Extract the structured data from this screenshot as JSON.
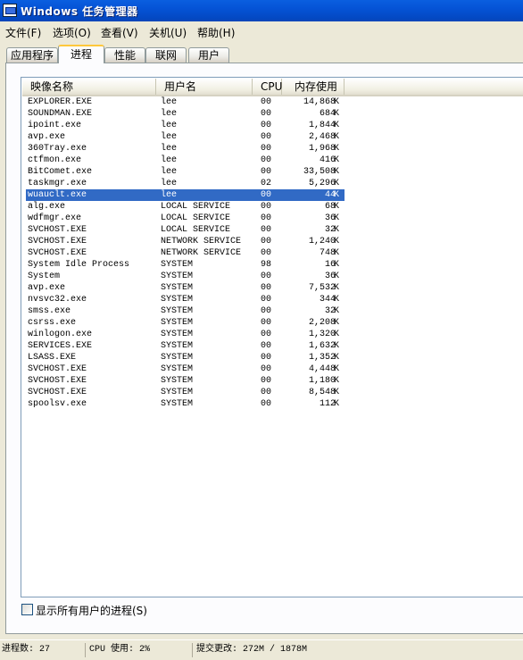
{
  "window": {
    "title": "Windows 任务管理器"
  },
  "menu": [
    "文件(F)",
    "选项(O)",
    "查看(V)",
    "关机(U)",
    "帮助(H)"
  ],
  "tabs": [
    "应用程序",
    "进程",
    "性能",
    "联网",
    "用户"
  ],
  "active_tab": "进程",
  "columns": {
    "name": "映像名称",
    "user": "用户名",
    "cpu": "CPU",
    "mem": "内存使用"
  },
  "processes": [
    {
      "name": "EXPLORER.EXE",
      "user": "lee",
      "cpu": "00",
      "mem": "14,868",
      "unit": "K"
    },
    {
      "name": "SOUNDMAN.EXE",
      "user": "lee",
      "cpu": "00",
      "mem": "684",
      "unit": "K"
    },
    {
      "name": "ipoint.exe",
      "user": "lee",
      "cpu": "00",
      "mem": "1,844",
      "unit": "K"
    },
    {
      "name": "avp.exe",
      "user": "lee",
      "cpu": "00",
      "mem": "2,468",
      "unit": "K"
    },
    {
      "name": "360Tray.exe",
      "user": "lee",
      "cpu": "00",
      "mem": "1,968",
      "unit": "K"
    },
    {
      "name": "ctfmon.exe",
      "user": "lee",
      "cpu": "00",
      "mem": "416",
      "unit": "K"
    },
    {
      "name": "BitComet.exe",
      "user": "lee",
      "cpu": "00",
      "mem": "33,508",
      "unit": "K"
    },
    {
      "name": "taskmgr.exe",
      "user": "lee",
      "cpu": "02",
      "mem": "5,296",
      "unit": "K"
    },
    {
      "name": "wuauclt.exe",
      "user": "lee",
      "cpu": "00",
      "mem": "44",
      "unit": "K",
      "selected": true
    },
    {
      "name": "alg.exe",
      "user": "LOCAL SERVICE",
      "cpu": "00",
      "mem": "68",
      "unit": "K"
    },
    {
      "name": "wdfmgr.exe",
      "user": "LOCAL SERVICE",
      "cpu": "00",
      "mem": "36",
      "unit": "K"
    },
    {
      "name": "SVCHOST.EXE",
      "user": "LOCAL SERVICE",
      "cpu": "00",
      "mem": "32",
      "unit": "K"
    },
    {
      "name": "SVCHOST.EXE",
      "user": "NETWORK SERVICE",
      "cpu": "00",
      "mem": "1,240",
      "unit": "K"
    },
    {
      "name": "SVCHOST.EXE",
      "user": "NETWORK SERVICE",
      "cpu": "00",
      "mem": "748",
      "unit": "K"
    },
    {
      "name": "System Idle Process",
      "user": "SYSTEM",
      "cpu": "98",
      "mem": "16",
      "unit": "K"
    },
    {
      "name": "System",
      "user": "SYSTEM",
      "cpu": "00",
      "mem": "36",
      "unit": "K"
    },
    {
      "name": "avp.exe",
      "user": "SYSTEM",
      "cpu": "00",
      "mem": "7,532",
      "unit": "K"
    },
    {
      "name": "nvsvc32.exe",
      "user": "SYSTEM",
      "cpu": "00",
      "mem": "344",
      "unit": "K"
    },
    {
      "name": "smss.exe",
      "user": "SYSTEM",
      "cpu": "00",
      "mem": "32",
      "unit": "K"
    },
    {
      "name": "csrss.exe",
      "user": "SYSTEM",
      "cpu": "00",
      "mem": "2,208",
      "unit": "K"
    },
    {
      "name": "winlogon.exe",
      "user": "SYSTEM",
      "cpu": "00",
      "mem": "1,320",
      "unit": "K"
    },
    {
      "name": "SERVICES.EXE",
      "user": "SYSTEM",
      "cpu": "00",
      "mem": "1,632",
      "unit": "K"
    },
    {
      "name": "LSASS.EXE",
      "user": "SYSTEM",
      "cpu": "00",
      "mem": "1,352",
      "unit": "K"
    },
    {
      "name": "SVCHOST.EXE",
      "user": "SYSTEM",
      "cpu": "00",
      "mem": "4,448",
      "unit": "K"
    },
    {
      "name": "SVCHOST.EXE",
      "user": "SYSTEM",
      "cpu": "00",
      "mem": "1,180",
      "unit": "K"
    },
    {
      "name": "SVCHOST.EXE",
      "user": "SYSTEM",
      "cpu": "00",
      "mem": "8,548",
      "unit": "K"
    },
    {
      "name": "spoolsv.exe",
      "user": "SYSTEM",
      "cpu": "00",
      "mem": "112",
      "unit": "K"
    }
  ],
  "show_all_users": {
    "label": "显示所有用户的进程(S)",
    "checked": false
  },
  "status": {
    "processes": "进程数: 27",
    "cpu": "CPU 使用: 2%",
    "commit": "提交更改: 272M / 1878M"
  },
  "colors": {
    "selection": "#316ac5",
    "titlebar": "#0553d6",
    "active_tab_accent": "#ffc83c"
  }
}
